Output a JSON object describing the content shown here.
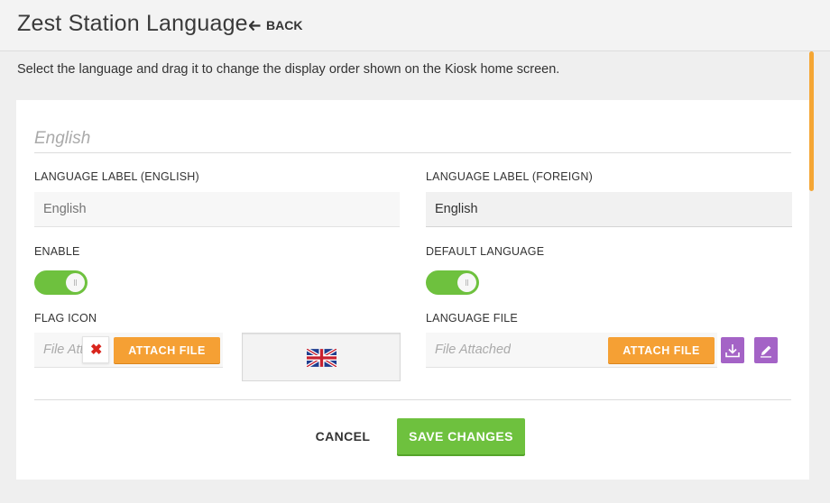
{
  "header": {
    "title": "Zest Station Language",
    "back_label": "BACK"
  },
  "description": "Select the language and drag it to change the display order shown on the Kiosk home screen.",
  "language": {
    "name": "English",
    "label_english": {
      "label": "LANGUAGE LABEL (ENGLISH)",
      "placeholder": "English"
    },
    "label_foreign": {
      "label": "LANGUAGE LABEL (FOREIGN)",
      "value": "English"
    },
    "enable": {
      "label": "ENABLE",
      "on": true
    },
    "default_language": {
      "label": "DEFAULT LANGUAGE",
      "on": true
    },
    "flag_icon": {
      "label": "FLAG ICON",
      "placeholder": "File Attached",
      "attach_label": "ATTACH FILE",
      "remove_icon": "close-icon",
      "preview_icon": "uk-flag-icon"
    },
    "language_file": {
      "label": "LANGUAGE FILE",
      "placeholder": "File Attached",
      "attach_label": "ATTACH FILE",
      "download_icon": "download-icon",
      "edit_icon": "edit-icon"
    }
  },
  "actions": {
    "cancel_label": "CANCEL",
    "save_label": "SAVE CHANGES"
  },
  "colors": {
    "accent_orange": "#f5a034",
    "toggle_green": "#6ec13e",
    "icon_purple": "#a463c6",
    "remove_red": "#d9251d"
  }
}
